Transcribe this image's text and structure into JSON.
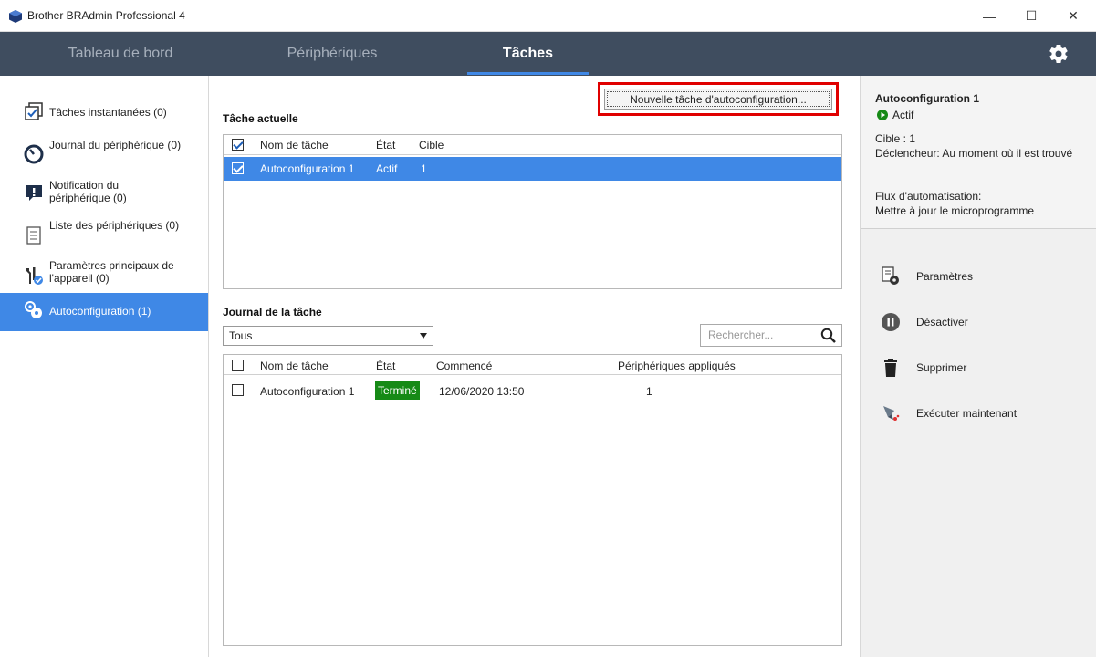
{
  "window": {
    "title": "Brother BRAdmin Professional 4",
    "minimize": "—",
    "maximize": "☐",
    "close": "✕"
  },
  "nav": {
    "tabs": [
      "Tableau de bord",
      "Périphériques",
      "Tâches"
    ]
  },
  "sidebar": {
    "items": [
      {
        "label": "Tâches instantanées (0)"
      },
      {
        "label": "Journal du périphérique (0)"
      },
      {
        "label": "Notification du périphérique (0)"
      },
      {
        "label": "Liste des périphériques (0)"
      },
      {
        "label": "Paramètres principaux de l'appareil (0)"
      },
      {
        "label": "Autoconfiguration (1)"
      }
    ]
  },
  "current_task": {
    "title": "Tâche actuelle",
    "new_button": "Nouvelle tâche d'autoconfiguration...",
    "columns": [
      "Nom de tâche",
      "État",
      "Cible"
    ],
    "rows": [
      {
        "name": "Autoconfiguration 1",
        "state": "Actif",
        "target": "1"
      }
    ]
  },
  "task_log": {
    "title": "Journal de la tâche",
    "filter": "Tous",
    "search_placeholder": "Rechercher...",
    "columns": [
      "Nom de tâche",
      "État",
      "Commencé",
      "Périphériques appliqués"
    ],
    "rows": [
      {
        "name": "Autoconfiguration 1",
        "state": "Terminé",
        "started": "12/06/2020 13:50",
        "devices": "1"
      }
    ]
  },
  "details": {
    "name": "Autoconfiguration 1",
    "status": "Actif",
    "target": "Cible : 1",
    "trigger": "Déclencheur: Au moment où il est trouvé",
    "flow_label": "Flux d'automatisation:",
    "flow_value": "Mettre à jour le microprogramme"
  },
  "actions": [
    "Paramètres",
    "Désactiver",
    "Supprimer",
    "Exécuter maintenant"
  ],
  "colors": {
    "nav_bg": "#3f4d5f",
    "accent": "#3f88e6",
    "success": "#168a16",
    "highlight_border": "#e00000"
  }
}
